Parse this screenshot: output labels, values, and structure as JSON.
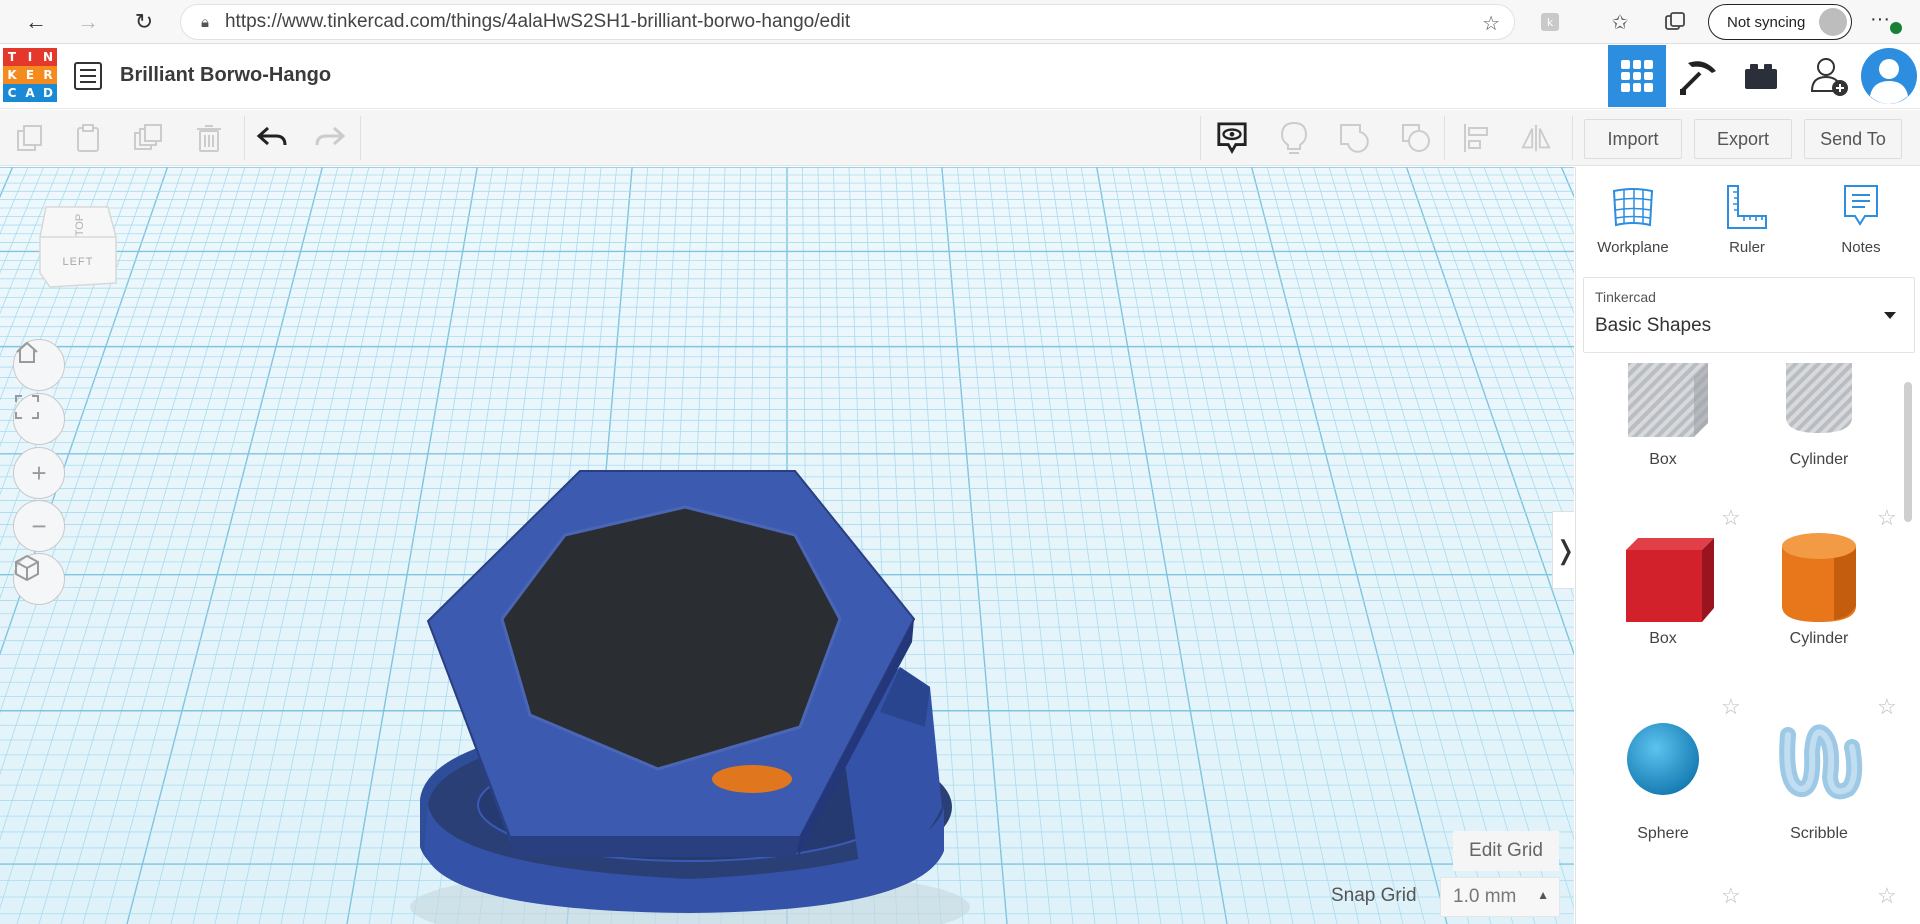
{
  "browser": {
    "url": "https://www.tinkercad.com/things/4alaHwS2SH1-brilliant-borwo-hango/edit",
    "sync_label": "Not syncing"
  },
  "app": {
    "logo_letters": [
      "T",
      "I",
      "N",
      "K",
      "E",
      "R",
      "C",
      "A",
      "D"
    ],
    "logo_colors": [
      "#e3382b",
      "#e3382b",
      "#e3382b",
      "#f58a1f",
      "#f58a1f",
      "#f58a1f",
      "#1a8ad6",
      "#1a8ad6",
      "#1a8ad6"
    ],
    "project_title": "Brilliant Borwo-Hango",
    "accent": "#2d8ddf"
  },
  "toolbar": {
    "import_label": "Import",
    "export_label": "Export",
    "send_label": "Send To"
  },
  "viewcube": {
    "top_label": "TOP",
    "left_label": "LEFT"
  },
  "workplane": {
    "edit_grid_label": "Edit Grid",
    "snap_grid_label": "Snap Grid",
    "snap_value": "1.0 mm"
  },
  "panel": {
    "tools": [
      {
        "label": "Workplane",
        "icon": "workplane-icon"
      },
      {
        "label": "Ruler",
        "icon": "ruler-icon"
      },
      {
        "label": "Notes",
        "icon": "notes-icon"
      }
    ],
    "library_category": "Tinkercad",
    "library_value": "Basic Shapes",
    "shapes": [
      {
        "name": "Box",
        "kind": "hole-box"
      },
      {
        "name": "Cylinder",
        "kind": "hole-cylinder"
      },
      {
        "name": "Box",
        "kind": "box",
        "color": "#d2212a"
      },
      {
        "name": "Cylinder",
        "kind": "cylinder",
        "color": "#e8771b"
      },
      {
        "name": "Sphere",
        "kind": "sphere",
        "color": "#1a9bd7"
      },
      {
        "name": "Scribble",
        "kind": "scribble",
        "color": "#9ec9e6"
      }
    ]
  }
}
